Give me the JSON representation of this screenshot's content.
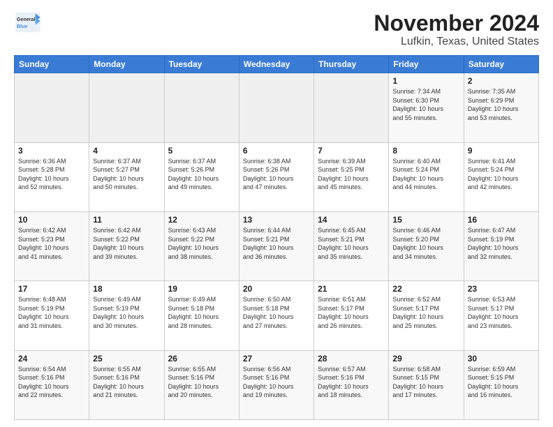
{
  "header": {
    "logo_general": "General",
    "logo_blue": "Blue",
    "title": "November 2024",
    "subtitle": "Lufkin, Texas, United States"
  },
  "weekdays": [
    "Sunday",
    "Monday",
    "Tuesday",
    "Wednesday",
    "Thursday",
    "Friday",
    "Saturday"
  ],
  "weeks": [
    [
      {
        "day": "",
        "info": ""
      },
      {
        "day": "",
        "info": ""
      },
      {
        "day": "",
        "info": ""
      },
      {
        "day": "",
        "info": ""
      },
      {
        "day": "",
        "info": ""
      },
      {
        "day": "1",
        "info": "Sunrise: 7:34 AM\nSunset: 6:30 PM\nDaylight: 10 hours\nand 55 minutes."
      },
      {
        "day": "2",
        "info": "Sunrise: 7:35 AM\nSunset: 6:29 PM\nDaylight: 10 hours\nand 53 minutes."
      }
    ],
    [
      {
        "day": "3",
        "info": "Sunrise: 6:36 AM\nSunset: 5:28 PM\nDaylight: 10 hours\nand 52 minutes."
      },
      {
        "day": "4",
        "info": "Sunrise: 6:37 AM\nSunset: 5:27 PM\nDaylight: 10 hours\nand 50 minutes."
      },
      {
        "day": "5",
        "info": "Sunrise: 6:37 AM\nSunset: 5:26 PM\nDaylight: 10 hours\nand 49 minutes."
      },
      {
        "day": "6",
        "info": "Sunrise: 6:38 AM\nSunset: 5:26 PM\nDaylight: 10 hours\nand 47 minutes."
      },
      {
        "day": "7",
        "info": "Sunrise: 6:39 AM\nSunset: 5:25 PM\nDaylight: 10 hours\nand 45 minutes."
      },
      {
        "day": "8",
        "info": "Sunrise: 6:40 AM\nSunset: 5:24 PM\nDaylight: 10 hours\nand 44 minutes."
      },
      {
        "day": "9",
        "info": "Sunrise: 6:41 AM\nSunset: 5:24 PM\nDaylight: 10 hours\nand 42 minutes."
      }
    ],
    [
      {
        "day": "10",
        "info": "Sunrise: 6:42 AM\nSunset: 5:23 PM\nDaylight: 10 hours\nand 41 minutes."
      },
      {
        "day": "11",
        "info": "Sunrise: 6:42 AM\nSunset: 5:22 PM\nDaylight: 10 hours\nand 39 minutes."
      },
      {
        "day": "12",
        "info": "Sunrise: 6:43 AM\nSunset: 5:22 PM\nDaylight: 10 hours\nand 38 minutes."
      },
      {
        "day": "13",
        "info": "Sunrise: 6:44 AM\nSunset: 5:21 PM\nDaylight: 10 hours\nand 36 minutes."
      },
      {
        "day": "14",
        "info": "Sunrise: 6:45 AM\nSunset: 5:21 PM\nDaylight: 10 hours\nand 35 minutes."
      },
      {
        "day": "15",
        "info": "Sunrise: 6:46 AM\nSunset: 5:20 PM\nDaylight: 10 hours\nand 34 minutes."
      },
      {
        "day": "16",
        "info": "Sunrise: 6:47 AM\nSunset: 5:19 PM\nDaylight: 10 hours\nand 32 minutes."
      }
    ],
    [
      {
        "day": "17",
        "info": "Sunrise: 6:48 AM\nSunset: 5:19 PM\nDaylight: 10 hours\nand 31 minutes."
      },
      {
        "day": "18",
        "info": "Sunrise: 6:49 AM\nSunset: 5:19 PM\nDaylight: 10 hours\nand 30 minutes."
      },
      {
        "day": "19",
        "info": "Sunrise: 6:49 AM\nSunset: 5:18 PM\nDaylight: 10 hours\nand 28 minutes."
      },
      {
        "day": "20",
        "info": "Sunrise: 6:50 AM\nSunset: 5:18 PM\nDaylight: 10 hours\nand 27 minutes."
      },
      {
        "day": "21",
        "info": "Sunrise: 6:51 AM\nSunset: 5:17 PM\nDaylight: 10 hours\nand 26 minutes."
      },
      {
        "day": "22",
        "info": "Sunrise: 6:52 AM\nSunset: 5:17 PM\nDaylight: 10 hours\nand 25 minutes."
      },
      {
        "day": "23",
        "info": "Sunrise: 6:53 AM\nSunset: 5:17 PM\nDaylight: 10 hours\nand 23 minutes."
      }
    ],
    [
      {
        "day": "24",
        "info": "Sunrise: 6:54 AM\nSunset: 5:16 PM\nDaylight: 10 hours\nand 22 minutes."
      },
      {
        "day": "25",
        "info": "Sunrise: 6:55 AM\nSunset: 5:16 PM\nDaylight: 10 hours\nand 21 minutes."
      },
      {
        "day": "26",
        "info": "Sunrise: 6:55 AM\nSunset: 5:16 PM\nDaylight: 10 hours\nand 20 minutes."
      },
      {
        "day": "27",
        "info": "Sunrise: 6:56 AM\nSunset: 5:16 PM\nDaylight: 10 hours\nand 19 minutes."
      },
      {
        "day": "28",
        "info": "Sunrise: 6:57 AM\nSunset: 5:16 PM\nDaylight: 10 hours\nand 18 minutes."
      },
      {
        "day": "29",
        "info": "Sunrise: 6:58 AM\nSunset: 5:15 PM\nDaylight: 10 hours\nand 17 minutes."
      },
      {
        "day": "30",
        "info": "Sunrise: 6:59 AM\nSunset: 5:15 PM\nDaylight: 10 hours\nand 16 minutes."
      }
    ]
  ]
}
